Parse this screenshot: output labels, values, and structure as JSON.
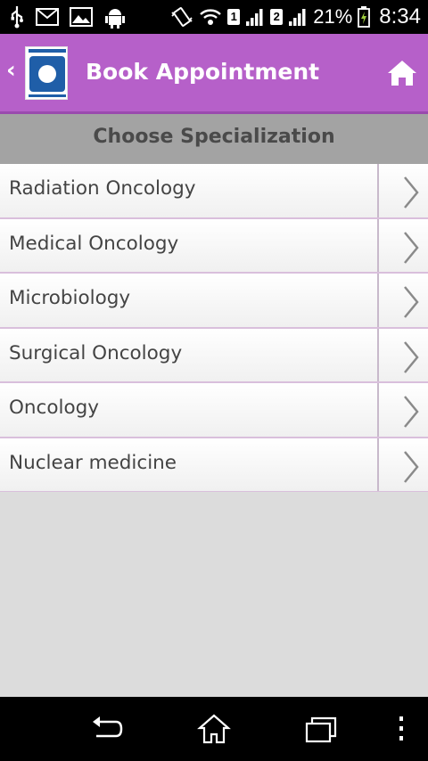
{
  "status_bar": {
    "sim1": "1",
    "sim2": "2",
    "battery": "21%",
    "time": "8:34",
    "icons": [
      "usb-icon",
      "gmail-icon",
      "gallery-icon",
      "android-icon",
      "vibrate-icon",
      "wifi-icon",
      "signal-icon",
      "battery-charging-icon"
    ]
  },
  "app_bar": {
    "title": "Book Appointment",
    "back_icon": "chevron-left-icon",
    "logo": "hospital-logo",
    "home_icon": "home-icon",
    "color": "#b660c9"
  },
  "section": {
    "title": "Choose Specialization"
  },
  "specializations": [
    {
      "label": "Radiation Oncology"
    },
    {
      "label": "Medical Oncology"
    },
    {
      "label": "Microbiology"
    },
    {
      "label": "Surgical Oncology"
    },
    {
      "label": "Oncology"
    },
    {
      "label": "Nuclear medicine"
    }
  ],
  "nav_bar": {
    "buttons": [
      "back-icon",
      "home-icon",
      "recent-apps-icon",
      "menu-icon"
    ]
  }
}
